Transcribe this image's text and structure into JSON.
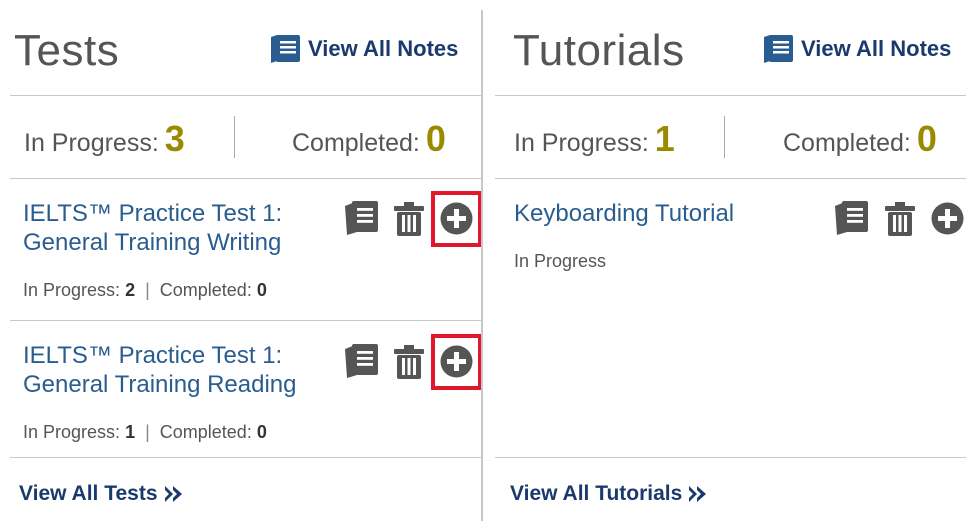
{
  "tests": {
    "title": "Tests",
    "view_all_notes": "View All Notes",
    "in_progress_label": "In Progress:",
    "in_progress_count": "3",
    "completed_label": "Completed:",
    "completed_count": "0",
    "items": [
      {
        "title_line1": "IELTS™ Practice Test 1:",
        "title_line2": "General Training Writing",
        "ip_label": "In Progress:",
        "ip_count": "2",
        "sep": "|",
        "c_label": "Completed:",
        "c_count": "0"
      },
      {
        "title_line1": "IELTS™ Practice Test 1:",
        "title_line2": "General Training Reading",
        "ip_label": "In Progress:",
        "ip_count": "1",
        "sep": "|",
        "c_label": "Completed:",
        "c_count": "0"
      }
    ],
    "view_all": "View All Tests"
  },
  "tutorials": {
    "title": "Tutorials",
    "view_all_notes": "View All Notes",
    "in_progress_label": "In Progress:",
    "in_progress_count": "1",
    "completed_label": "Completed:",
    "completed_count": "0",
    "items": [
      {
        "title": "Keyboarding Tutorial",
        "status": "In Progress"
      }
    ],
    "view_all": "View All Tutorials"
  },
  "colors": {
    "link": "#2a5d8f",
    "link_bold": "#1a3a6e",
    "count": "#9a8a00",
    "icon": "#555555",
    "highlight": "#e0182d"
  },
  "icons": [
    "notes-icon",
    "trash-icon",
    "plus-circle-icon",
    "double-chevron-right-icon"
  ]
}
